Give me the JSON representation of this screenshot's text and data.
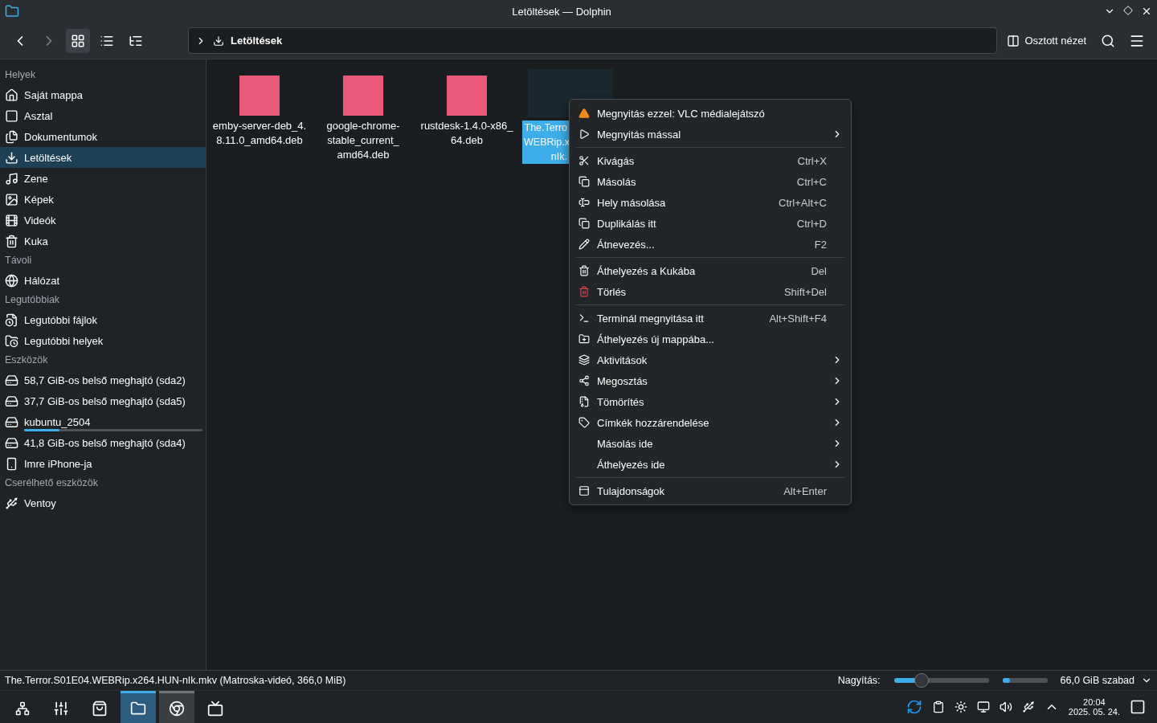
{
  "window": {
    "title": "Letöltések — Dolphin"
  },
  "toolbar": {
    "views": [
      {
        "kind": "icons",
        "selected": true
      },
      {
        "kind": "details",
        "selected": false
      },
      {
        "kind": "tree",
        "selected": false
      }
    ],
    "breadcrumb": "Letöltések",
    "split_button": "Osztott nézet"
  },
  "sidebar": {
    "sections": [
      {
        "title": "Helyek",
        "items": [
          {
            "label": "Saját mappa",
            "selected": false
          },
          {
            "label": "Asztal",
            "selected": false
          },
          {
            "label": "Dokumentumok",
            "selected": false
          },
          {
            "label": "Letöltések",
            "selected": true
          },
          {
            "label": "Zene",
            "selected": false
          },
          {
            "label": "Képek",
            "selected": false
          },
          {
            "label": "Videók",
            "selected": false
          },
          {
            "label": "Kuka",
            "selected": false
          }
        ]
      },
      {
        "title": "Távoli",
        "items": [
          {
            "label": "Hálózat",
            "selected": false
          }
        ]
      },
      {
        "title": "Legutóbbiak",
        "items": [
          {
            "label": "Legutóbbi fájlok",
            "selected": false
          },
          {
            "label": "Legutóbbi helyek",
            "selected": false
          }
        ]
      },
      {
        "title": "Eszközök",
        "items": [
          {
            "label": "58,7 GiB-os belső meghajtó (sda2)",
            "selected": false
          },
          {
            "label": "37,7 GiB-os belső meghajtó (sda5)",
            "selected": false
          },
          {
            "label": "kubuntu_2504",
            "selected": false,
            "level": 0.2
          },
          {
            "label": "41,8 GiB-os belső meghajtó (sda4)",
            "selected": false
          },
          {
            "label": "Imre iPhone-ja",
            "selected": false
          }
        ]
      },
      {
        "title": "Cserélhető eszközök",
        "items": [
          {
            "label": "Ventoy",
            "selected": false
          }
        ]
      }
    ]
  },
  "files": [
    {
      "kind": "package",
      "name_lines": [
        "emby-server-deb_4.",
        "8.11.0_amd64.deb"
      ],
      "selected": false
    },
    {
      "kind": "package",
      "name_lines": [
        "google-chrome-",
        "stable_current_",
        "amd64.deb"
      ],
      "selected": false
    },
    {
      "kind": "package",
      "name_lines": [
        "rustdesk-1.4.0-x86_",
        "64.deb"
      ],
      "selected": false
    },
    {
      "kind": "video",
      "name_lines": [
        "The.Terro",
        "WEBRip.x",
        "nIk."
      ],
      "selected": true
    }
  ],
  "context_menu": {
    "sections": [
      [
        {
          "label": "Megnyitás ezzel: VLC médialejátszó",
          "submenu": false
        },
        {
          "label": "Megnyitás mással",
          "submenu": true
        }
      ],
      [
        {
          "label": "Kivágás",
          "shortcut": "Ctrl+X",
          "submenu": false
        },
        {
          "label": "Másolás",
          "shortcut": "Ctrl+C",
          "submenu": false
        },
        {
          "label": "Hely másolása",
          "shortcut": "Ctrl+Alt+C",
          "submenu": false
        },
        {
          "label": "Duplikálás itt",
          "shortcut": "Ctrl+D",
          "submenu": false
        },
        {
          "label": "Átnevezés...",
          "shortcut": "F2",
          "submenu": false
        }
      ],
      [
        {
          "label": "Áthelyezés a Kukába",
          "shortcut": "Del",
          "submenu": false
        },
        {
          "label": "Törlés",
          "shortcut": "Shift+Del",
          "submenu": false
        }
      ],
      [
        {
          "label": "Terminál megnyitása itt",
          "shortcut": "Alt+Shift+F4",
          "submenu": false
        },
        {
          "label": "Áthelyezés új mappába...",
          "submenu": false
        },
        {
          "label": "Aktivitások",
          "submenu": true
        },
        {
          "label": "Megosztás",
          "submenu": true
        },
        {
          "label": "Tömörítés",
          "submenu": true
        },
        {
          "label": "Címkék hozzárendelése",
          "submenu": true
        },
        {
          "label": "Másolás ide",
          "submenu": true
        },
        {
          "label": "Áthelyezés ide",
          "submenu": true
        }
      ],
      [
        {
          "label": "Tulajdonságok",
          "shortcut": "Alt+Enter",
          "submenu": false
        }
      ]
    ]
  },
  "status_bar": {
    "info": "The.Terror.S01E04.WEBRip.x264.HUN-nIk.mkv (Matroska-videó, 366,0 MiB)",
    "zoom_label": "Nagyítás:",
    "zoom": {
      "level": 0.29
    },
    "space": {
      "level": 0.16
    },
    "free": "66,0 GiB szabad"
  },
  "taskbar": {
    "tasks": [
      {
        "kind": "settings",
        "selected": false,
        "open": false
      },
      {
        "kind": "store",
        "selected": false,
        "open": false
      },
      {
        "kind": "files",
        "selected": true,
        "open": true
      },
      {
        "kind": "browser",
        "selected": false,
        "open": true
      },
      {
        "kind": "display",
        "selected": false,
        "open": false
      }
    ],
    "time": "20:04",
    "date": "2025. 05. 24."
  }
}
